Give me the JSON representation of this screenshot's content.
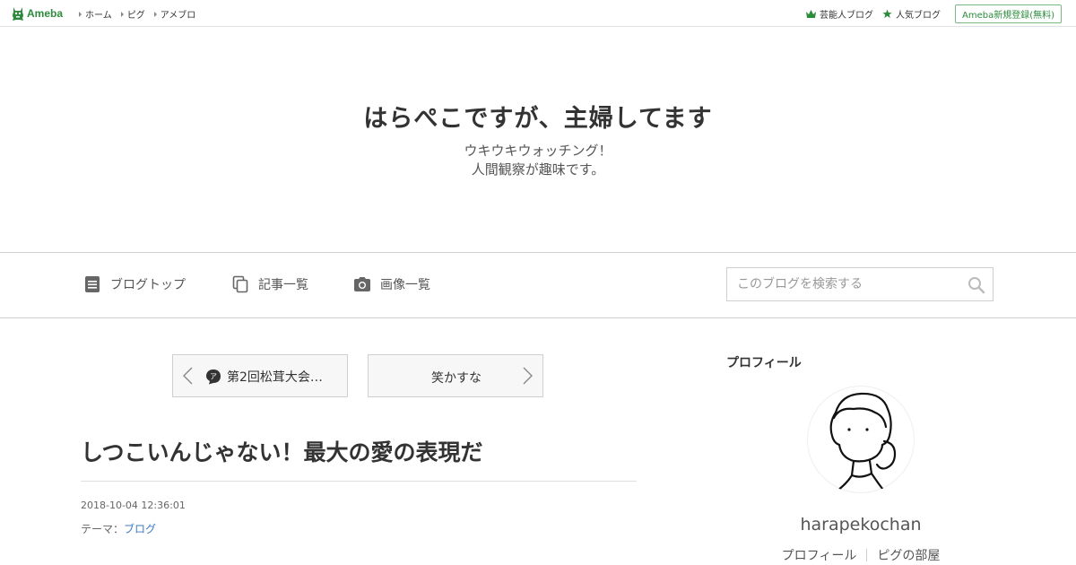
{
  "topbar": {
    "logo_text": "Ameba",
    "nav": [
      {
        "label": "ホーム"
      },
      {
        "label": "ピグ"
      },
      {
        "label": "アメブロ"
      }
    ],
    "celebrity_blog": "芸能人ブログ",
    "popular_blog": "人気ブログ",
    "signup": "Ameba新規登録(無料)"
  },
  "header": {
    "title": "はらぺこですが、主婦してます",
    "desc_line1": "ウキウキウォッチング！",
    "desc_line2": "人間観察が趣味です。"
  },
  "gnav": {
    "blog_top": "ブログトップ",
    "entry_list": "記事一覧",
    "image_list": "画像一覧",
    "search_placeholder": "このブログを検索する"
  },
  "pager": {
    "prev_label": "第2回松茸大会…",
    "next_label": "笑かすな"
  },
  "article": {
    "title": "しつこいんじゃない！最大の愛の表現だ",
    "date": "2018-10-04 12:36:01",
    "theme_prefix": "テーマ：",
    "theme_link": "ブログ"
  },
  "sidebar": {
    "heading": "プロフィール",
    "name": "harapekochan",
    "links": [
      {
        "label": "プロフィール"
      },
      {
        "label": "ピグの部屋"
      }
    ]
  },
  "colors": {
    "brand_green": "#2d8c3c",
    "link_blue": "#3d7ac2",
    "border": "#cfcfcf"
  },
  "icons": [
    "ameba-logo-icon",
    "crown-icon",
    "star-icon",
    "document-icon",
    "copy-icon",
    "camera-icon",
    "search-icon",
    "chevron-left-icon",
    "chevron-right-icon",
    "ameba-badge-icon"
  ]
}
